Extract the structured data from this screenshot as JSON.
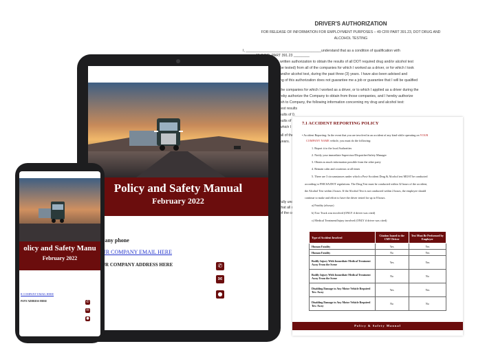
{
  "back_document": {
    "title": "DRIVER'S AUTHORIZATION",
    "subtitle_line1": "FOR RELEASE OF INFORMATION FOR EMPLOYMENT PURPOSES – 49 CFR PART 391.23, DOT DRUG AND",
    "subtitle_line2": "ALCOHOL TESTING",
    "line1": "I, ______________________________________understand that as a condition of qualification with",
    "line2": "______ 49 C.F.R. PART 391.23 ________",
    "line3": "written authorization to obtain the results of all DOT required drug and/or alcohol test",
    "line4": "be tested) from all of the companies for which I worked as a driver, or for which I took",
    "line5": "and/or alcohol test, during the past three (3) years. I have also been advised and",
    "line6": "ng of this authorization does not guarantee me a job or guarantee that I will be qualified",
    "line7": "the companies for which I worked as a driver, or to which I applied as a driver during the",
    "line8": "reby authorize the Company to obtain from those companies, and I hereby authorize",
    "line9": "ish to Company, the following information concerning my drug and alcohol test:",
    "line10": "test results",
    "line11": "sults of 0.",
    "line12": "sults of 0.",
    "line13": "which I ref",
    "line14": "all of the co",
    "line15": "years.",
    "line16": "fully und",
    "line17": "that all of tl",
    "line18": "of the co"
  },
  "policy_page": {
    "section_title": "7.1 ACCIDENT REPORTING POLICY",
    "intro_a": "• Accident Reporting: In the event that you are involved in an accident of any kind while operating on",
    "intro_company": "YOUR",
    "intro_b": "COMPANY NAME",
    "intro_c": "vehicle, you must do the following:",
    "items": [
      "1.      Report it to the local Authorities",
      "2.      Notify your immediate Supervisor/Dispatcher/Safety Manager",
      "3.      Obtain as much information possible from the other party",
      "4.      Remain calm and courteous at all times",
      "5.      There are 3 circumstances under which a Post-Accident Drug & Alcohol test MUST be conducted",
      "according to FMCSA/DOT regulations. The Drug Test must be conducted within 32 hours of the accident,",
      "the Alcohol Test within 2 hours. If the Alcohol Test is not conducted within 2 hours, the employee should",
      "continue to make and effort to have the driver tested for up to 8 hours.",
      "a)      Fatality (always)",
      "b)      Tow Truck was involved (ONLY if driver was cited)",
      "c)      Medical Treatment/Injury involved (ONLY if driver was cited)"
    ],
    "table_headers": [
      "Type of Accident Involved",
      "Citation Issued to the CMV Driver",
      "Test Must Be Performed by Employer"
    ],
    "table_rows": [
      [
        "Human Fatality",
        "Yes",
        "Yes"
      ],
      [
        "Human Fatality",
        "No",
        "Yes"
      ],
      [
        "Bodily Injury With Immediate Medical Treatment Away From the Scene",
        "Yes",
        "Yes"
      ],
      [
        "Bodily Injury With Immediate Medical Treatment Away From the Scene",
        "No",
        "No"
      ],
      [
        "Disabling Damage to Any Motor Vehicle Required Tow Away",
        "Yes",
        "Yes"
      ],
      [
        "Disabling Damage to Any Motor Vehicle Required Tow Away",
        "No",
        "No"
      ]
    ],
    "footer": "Policy & Safety Manual"
  },
  "tablet": {
    "title": "Policy and Safety Manual",
    "date": "February 2022",
    "phone_label": "pany phone",
    "email_label": "UR COMPANY EMAIL HERE",
    "address_label": "UR COMPANY ADDRESS HERE"
  },
  "phone": {
    "title": "olicy and Safety Manu",
    "date": "February 2022",
    "email_label": "R COMPANY EMAIL HERE",
    "address_label": "PANY ADDRESS HERE"
  },
  "colors": {
    "brand": "#6b0d0d",
    "device": "#1d1d1f"
  },
  "icons": [
    "phone-icon",
    "mail-icon",
    "location-icon"
  ]
}
